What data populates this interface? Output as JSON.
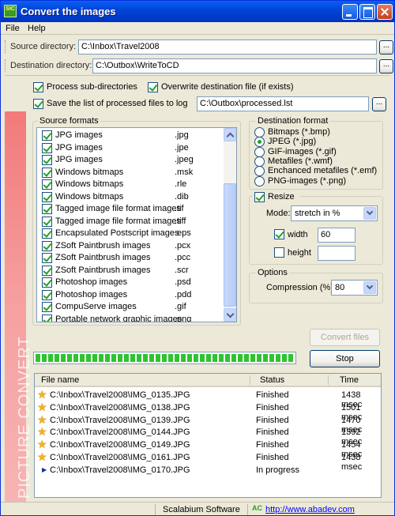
{
  "window": {
    "title": "Convert the images",
    "icon_text": "SIC"
  },
  "menu": [
    "File",
    "Help"
  ],
  "directories": {
    "source_label": "Source directory:",
    "source_value": "C:\\Inbox\\Travel2008",
    "destination_label": "Destination directory:",
    "destination_value": "C:\\Outbox\\WriteToCD",
    "browse_label": "..."
  },
  "options": {
    "process_subdirs": {
      "label": "Process sub-directories",
      "checked": true
    },
    "overwrite": {
      "label": "Overwrite destination file (if exists)",
      "checked": true
    },
    "save_log": {
      "label": "Save the list of processed files to log",
      "checked": true
    },
    "log_path": "C:\\Outbox\\processed.lst"
  },
  "source_formats": {
    "title": "Source formats",
    "items": [
      {
        "name": "JPG images",
        "ext": ".jpg",
        "checked": true
      },
      {
        "name": "JPG images",
        "ext": ".jpe",
        "checked": true
      },
      {
        "name": "JPG images",
        "ext": ".jpeg",
        "checked": true
      },
      {
        "name": "Windows bitmaps",
        "ext": ".msk",
        "checked": true
      },
      {
        "name": "Windows bitmaps",
        "ext": ".rle",
        "checked": true
      },
      {
        "name": "Windows bitmaps",
        "ext": ".dib",
        "checked": true
      },
      {
        "name": "Tagged image file format images",
        "ext": ".tif",
        "checked": true
      },
      {
        "name": "Tagged image file format images",
        "ext": ".tiff",
        "checked": true
      },
      {
        "name": "Encapsulated Postscript images",
        "ext": ".eps",
        "checked": true
      },
      {
        "name": "ZSoft Paintbrush images",
        "ext": ".pcx",
        "checked": true
      },
      {
        "name": "ZSoft Paintbrush images",
        "ext": ".pcc",
        "checked": true
      },
      {
        "name": "ZSoft Paintbrush images",
        "ext": ".scr",
        "checked": true
      },
      {
        "name": "Photoshop images",
        "ext": ".psd",
        "checked": true
      },
      {
        "name": "Photoshop images",
        "ext": ".pdd",
        "checked": true
      },
      {
        "name": "CompuServe images",
        "ext": ".gif",
        "checked": true
      },
      {
        "name": "Portable network graphic images",
        "ext": ".png",
        "checked": true
      }
    ]
  },
  "destination_format": {
    "title": "Destination format",
    "options": [
      {
        "label": "Bitmaps (*.bmp)",
        "selected": false
      },
      {
        "label": "JPEG (*.jpg)",
        "selected": true
      },
      {
        "label": "GIF-images (*.gif)",
        "selected": false
      },
      {
        "label": "Metafiles (*.wmf)",
        "selected": false
      },
      {
        "label": "Enchanced metafiles (*.emf)",
        "selected": false
      },
      {
        "label": "PNG-images (*.png)",
        "selected": false
      }
    ]
  },
  "resize": {
    "label": "Resize",
    "checked": true,
    "mode_label": "Mode:",
    "mode_value": "stretch in %",
    "width_label": "width",
    "width_checked": true,
    "width_value": "60",
    "height_label": "height",
    "height_checked": false,
    "height_value": ""
  },
  "compression": {
    "title": "Options",
    "label": "Compression (%):",
    "value": "80"
  },
  "actions": {
    "convert_label": "Convert files",
    "convert_enabled": false,
    "stop_label": "Stop"
  },
  "progress": {
    "fraction": 1.0
  },
  "side_banner": "PICTURE CONVERT",
  "results": {
    "columns": [
      "File name",
      "Status",
      "Time"
    ],
    "rows": [
      {
        "file": "C:\\Inbox\\Travel2008\\IMG_0135.JPG",
        "status": "Finished",
        "time": "1438 msec",
        "icon": "star-icon"
      },
      {
        "file": "C:\\Inbox\\Travel2008\\IMG_0138.JPG",
        "status": "Finished",
        "time": "1501 msec",
        "icon": "star-icon"
      },
      {
        "file": "C:\\Inbox\\Travel2008\\IMG_0139.JPG",
        "status": "Finished",
        "time": "1470 msec",
        "icon": "star-icon"
      },
      {
        "file": "C:\\Inbox\\Travel2008\\IMG_0144.JPG",
        "status": "Finished",
        "time": "1392 msec",
        "icon": "star-icon"
      },
      {
        "file": "C:\\Inbox\\Travel2008\\IMG_0149.JPG",
        "status": "Finished",
        "time": "1454 msec",
        "icon": "star-icon"
      },
      {
        "file": "C:\\Inbox\\Travel2008\\IMG_0161.JPG",
        "status": "Finished",
        "time": "1438 msec",
        "icon": "star-icon"
      },
      {
        "file": "C:\\Inbox\\Travel2008\\IMG_0170.JPG",
        "status": "In progress",
        "time": "",
        "icon": "pointer-icon"
      }
    ]
  },
  "footer": {
    "company": "Scalabium Software",
    "url": "http://www.abadev.com",
    "url_logo": "AC"
  }
}
